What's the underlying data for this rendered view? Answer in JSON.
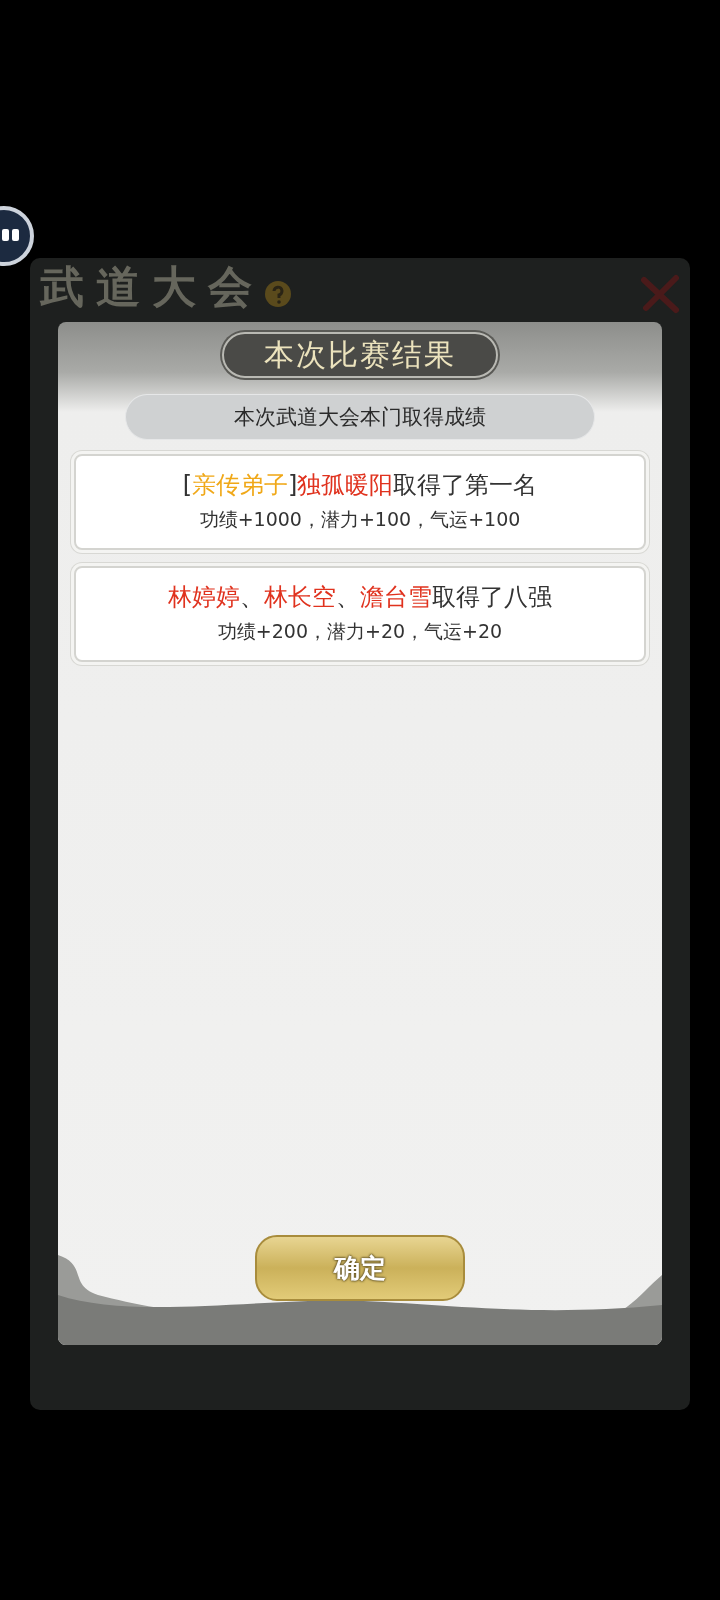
{
  "background_panel": {
    "title": "武道大会"
  },
  "dialog": {
    "title": "本次比赛结果",
    "subtitle": "本次武道大会本门取得成绩",
    "results": [
      {
        "headline": [
          {
            "text": "[",
            "color": "#333333"
          },
          {
            "text": "亲传弟子",
            "color": "#f0a818"
          },
          {
            "text": "]",
            "color": "#333333"
          },
          {
            "text": "独孤暖阳",
            "color": "#e0321e"
          },
          {
            "text": "取得了第一名",
            "color": "#333333"
          }
        ],
        "rewards": "功绩+1000，潜力+100，气运+100"
      },
      {
        "headline": [
          {
            "text": "林婷婷",
            "color": "#e0321e"
          },
          {
            "text": "、",
            "color": "#333333"
          },
          {
            "text": "林长空",
            "color": "#e0321e"
          },
          {
            "text": "、",
            "color": "#333333"
          },
          {
            "text": "澹台雪",
            "color": "#e0321e"
          },
          {
            "text": "取得了八强",
            "color": "#333333"
          }
        ],
        "rewards": "功绩+200，潜力+20，气运+20"
      }
    ],
    "confirm_button": "确定"
  }
}
